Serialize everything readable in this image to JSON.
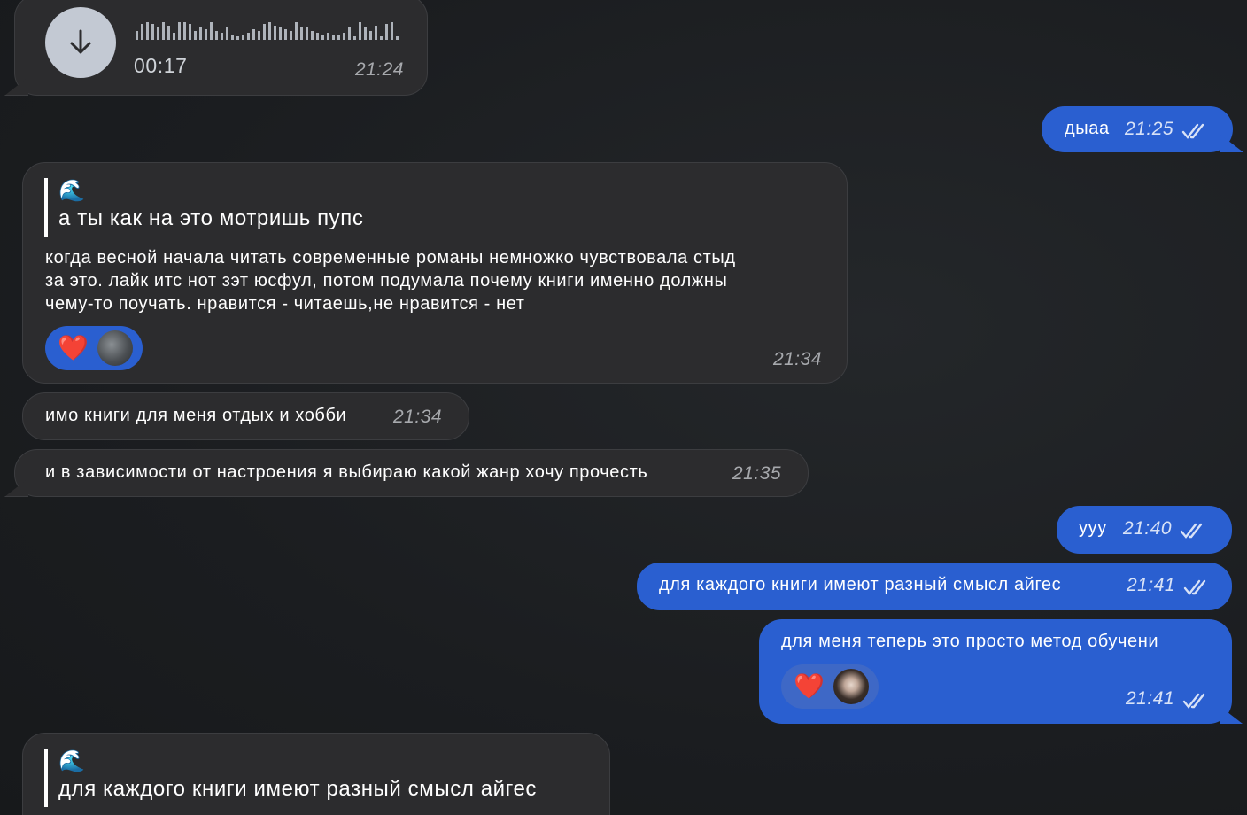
{
  "messages": {
    "voice": {
      "duration": "00:17",
      "time": "21:24",
      "icon": "download-arrow-icon"
    },
    "m1": {
      "text": "дыаа",
      "time": "21:25"
    },
    "m2": {
      "quote_emoji": "🌊",
      "quote_text": "а ты как на это мотришь пупс",
      "lines": [
        "когда весной начала читать современные романы немножко чувствовала стыд",
        "за это. лайк итс нот зэт юсфул, потом подумала почему книги именно должны",
        "чему-то поучать. нравится - читаешь,не нравится - нет"
      ],
      "reaction": "❤️",
      "time": "21:34"
    },
    "m3": {
      "text": "имо книги для меня отдых и хобби",
      "time": "21:34"
    },
    "m4": {
      "text": "и в зависимости от настроения я выбираю какой жанр хочу прочесть",
      "time": "21:35"
    },
    "m5": {
      "text": "ууу",
      "time": "21:40"
    },
    "m6": {
      "text": "для каждого книги имеют разный смысл айгес",
      "time": "21:41"
    },
    "m7": {
      "text": "для меня теперь это просто метод обучени",
      "reaction": "❤️",
      "time": "21:41"
    },
    "m8": {
      "quote_emoji": "🌊",
      "quote_text": "для каждого книги имеют разный смысл айгес"
    }
  },
  "colors": {
    "incoming_bubble": "#2c2c2e",
    "outgoing_bubble": "#2a5fd0",
    "background": "#1c1e21",
    "heart": "#e0262b"
  }
}
